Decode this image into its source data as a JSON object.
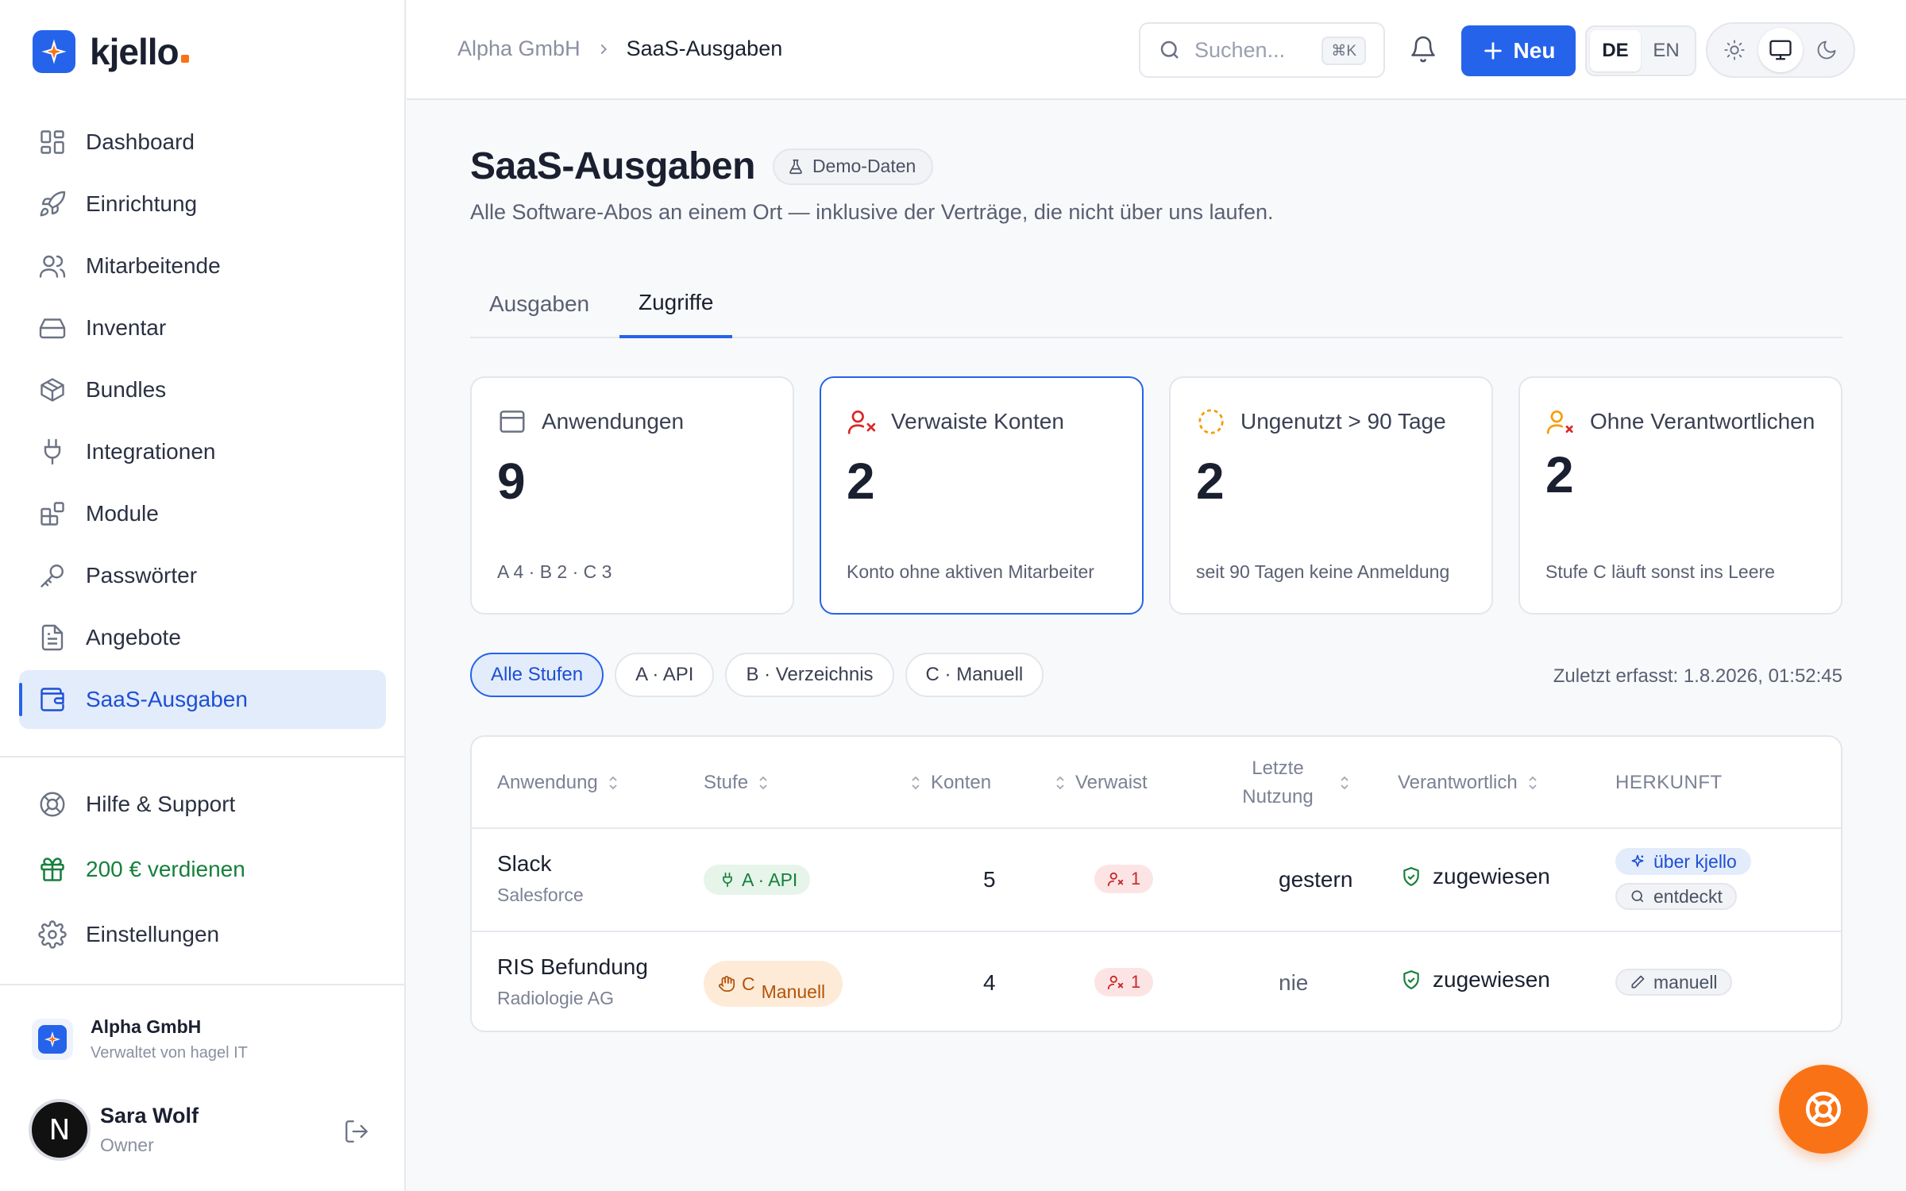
{
  "brand": {
    "name": "kjello",
    "accent": "#f97316",
    "logo_color": "#2563eb"
  },
  "sidebar": {
    "items": [
      {
        "label": "Dashboard",
        "icon": "dashboard-icon"
      },
      {
        "label": "Einrichtung",
        "icon": "rocket-icon"
      },
      {
        "label": "Mitarbeitende",
        "icon": "users-icon"
      },
      {
        "label": "Inventar",
        "icon": "hard-drive-icon"
      },
      {
        "label": "Bundles",
        "icon": "package-icon"
      },
      {
        "label": "Integrationen",
        "icon": "plug-icon"
      },
      {
        "label": "Module",
        "icon": "blocks-icon"
      },
      {
        "label": "Passwörter",
        "icon": "key-icon"
      },
      {
        "label": "Angebote",
        "icon": "document-icon"
      },
      {
        "label": "SaaS-Ausgaben",
        "icon": "wallet-icon",
        "active": true
      }
    ],
    "bottom": [
      {
        "label": "Hilfe & Support",
        "icon": "lifebuoy-icon"
      },
      {
        "label": "200 € verdienen",
        "icon": "gift-icon"
      },
      {
        "label": "Einstellungen",
        "icon": "gear-icon"
      }
    ],
    "org": {
      "name": "Alpha GmbH",
      "sub": "Verwaltet von hagel IT"
    },
    "user": {
      "name": "Sara Wolf",
      "role": "Owner",
      "initial": "N"
    }
  },
  "topbar": {
    "breadcrumb": [
      "Alpha GmbH",
      "SaaS-Ausgaben"
    ],
    "search": {
      "placeholder": "Suchen...",
      "shortcut": "⌘K"
    },
    "new_label": "Neu",
    "lang": [
      "DE",
      "EN"
    ],
    "lang_selected": "DE",
    "theme_selected": "system"
  },
  "page": {
    "title": "SaaS-Ausgaben",
    "badge": "Demo-Daten",
    "subtitle": "Alle Software-Abos an einem Ort — inklusive der Verträge, die nicht über uns laufen.",
    "tabs": [
      "Ausgaben",
      "Zugriffe"
    ],
    "active_tab": "Zugriffe"
  },
  "cards": [
    {
      "title": "Anwendungen",
      "value": "9",
      "note": "A 4 · B 2 · C 3",
      "icon": "window-icon"
    },
    {
      "title": "Verwaiste Konten",
      "value": "2",
      "note": "Konto ohne aktiven Mitarbeiter",
      "icon": "user-x-icon",
      "selected": true
    },
    {
      "title": "Ungenutzt > 90 Tage",
      "value": "2",
      "note": "seit 90 Tagen keine Anmeldung",
      "icon": "dashed-circle-icon"
    },
    {
      "title": "Ohne Verantwortlichen",
      "value": "2",
      "note": "Stufe C läuft sonst ins Leere",
      "icon": "user-warning-icon"
    }
  ],
  "filters": [
    "Alle Stufen",
    "A · API",
    "B · Verzeichnis",
    "C · Manuell"
  ],
  "filter_selected": "Alle Stufen",
  "captured": "Zuletzt erfasst: 1.8.2026, 01:52:45",
  "table": {
    "columns": [
      "Anwendung",
      "Stufe",
      "Konten",
      "Verwaist",
      "Letzte Nutzung",
      "Verantwortlich",
      "HERKUNFT"
    ],
    "rows": [
      {
        "app": "Slack",
        "vendor": "Salesforce",
        "tier": "A · API",
        "accounts": "5",
        "orphaned": "1",
        "last_used": "gestern",
        "owner": "zugewiesen",
        "origin": [
          "über kjello",
          "entdeckt"
        ]
      },
      {
        "app": "RIS Befundung",
        "vendor": "Radiologie AG",
        "tier_a": "C",
        "tier_b": "Manuell",
        "accounts": "4",
        "orphaned": "1",
        "last_used": "nie",
        "owner": "zugewiesen",
        "origin": [
          "manuell"
        ]
      }
    ]
  },
  "colors": {
    "primary": "#2563eb",
    "success": "#16803c",
    "danger": "#c62828",
    "warning": "#b45309"
  }
}
